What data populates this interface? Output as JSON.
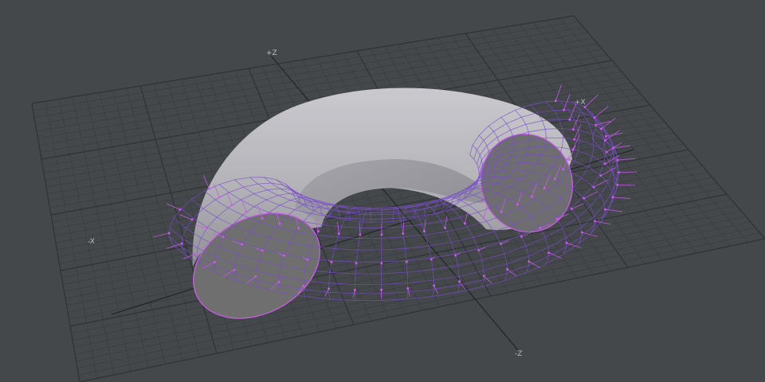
{
  "viewport": {
    "background": "#45484b",
    "axis_labels": {
      "pos_z": "+Z",
      "pos_x": "+X",
      "neg_x": "-X",
      "neg_z": "-Z"
    },
    "mesh": {
      "shape": "half-torus",
      "surface_color": "#b7b7bc",
      "cap_color": "#6f6f70",
      "edge_color": "#7b4ccf",
      "vertex_color": "#d25cf0",
      "normal_color": "#c45ae8"
    }
  }
}
